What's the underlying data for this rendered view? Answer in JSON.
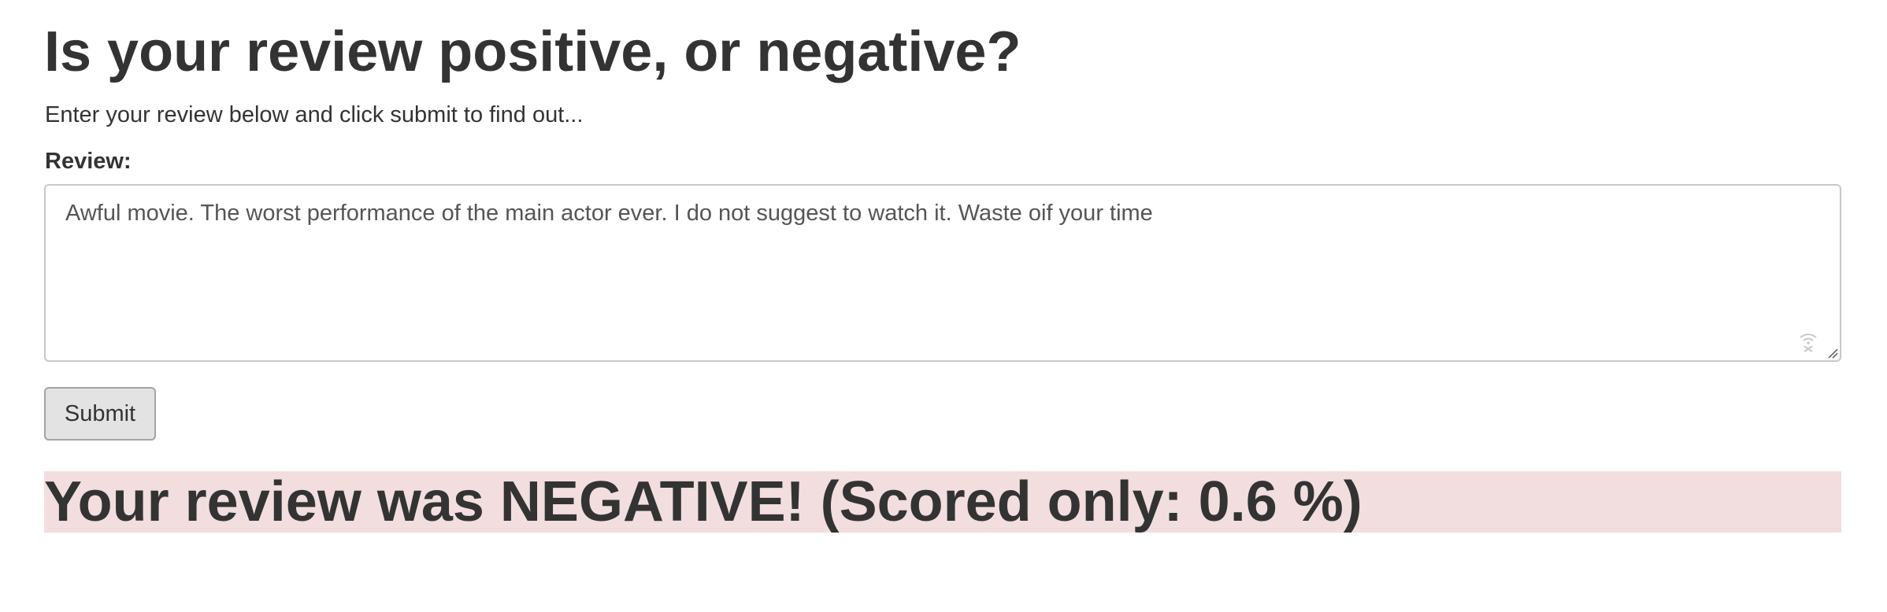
{
  "header": {
    "title": "Is your review positive, or negative?",
    "subtitle": "Enter your review below and click submit to find out..."
  },
  "form": {
    "review_label": "Review:",
    "review_value": "Awful movie. The worst performance of the main actor ever. I do not suggest to watch it. Waste oif your time",
    "submit_label": "Submit"
  },
  "result": {
    "text": "Your review was NEGATIVE! (Scored only: 0.6 %)",
    "banner_color": "#f2dede"
  },
  "icons": {
    "textarea_icon": "dictation-mic-icon",
    "resize": "resize-handle-icon"
  }
}
